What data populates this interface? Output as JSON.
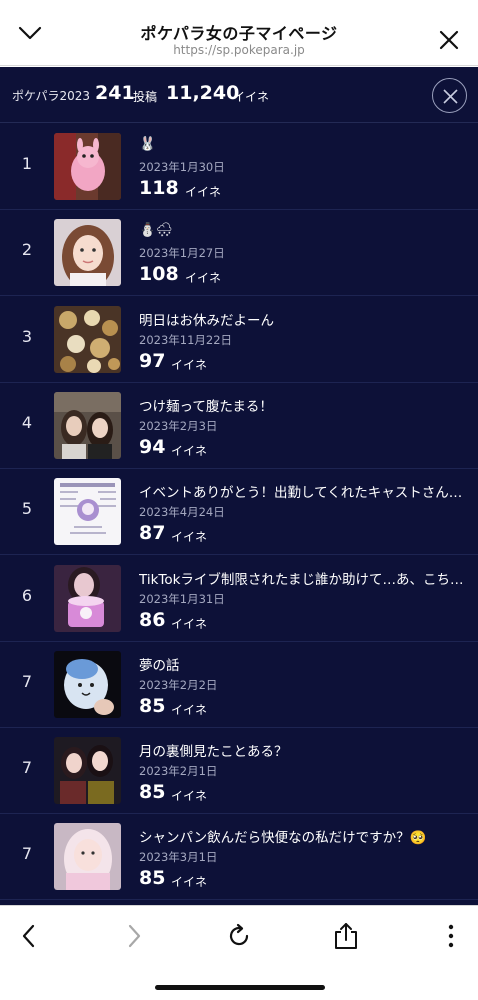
{
  "header": {
    "title": "ポケパラ女の子マイページ",
    "url": "https://sp.pokepara.jp"
  },
  "summary": {
    "tag": "ポケパラ2023",
    "posts_count": "241",
    "posts_unit": "投稿",
    "likes_count": "11,240",
    "likes_unit": "イイネ"
  },
  "like_unit": "イイネ",
  "posts": [
    {
      "rank": "1",
      "title": "🐰",
      "date": "2023年1月30日",
      "count": "118",
      "thumb": "pink-plush"
    },
    {
      "rank": "2",
      "title": "⛄🌨",
      "date": "2023年1月27日",
      "count": "108",
      "thumb": "selfie-brown-hair"
    },
    {
      "rank": "3",
      "title": "明日はお休みだよーん",
      "date": "2023年11月22日",
      "count": "97",
      "thumb": "gold-sweets"
    },
    {
      "rank": "4",
      "title": "つけ麺って腹たまる！",
      "date": "2023年2月3日",
      "count": "94",
      "thumb": "two-girls"
    },
    {
      "rank": "5",
      "title": "イベントありがとう！出勤してくれたキャストさん…",
      "date": "2023年4月24日",
      "count": "87",
      "thumb": "event-flyer"
    },
    {
      "rank": "6",
      "title": "TikTokライブ制限されたまじ誰か助けて…あ、こち…",
      "date": "2023年1月31日",
      "count": "86",
      "thumb": "purple-mug"
    },
    {
      "rank": "7",
      "title": "夢の話",
      "date": "2023年2月2日",
      "count": "85",
      "thumb": "blue-plush"
    },
    {
      "rank": "7",
      "title": "月の裏側見たことある？",
      "date": "2023年2月1日",
      "count": "85",
      "thumb": "two-girls-dark"
    },
    {
      "rank": "7",
      "title": "シャンパン飲んだら快便なの私だけですか？🥺",
      "date": "2023年3月1日",
      "count": "85",
      "thumb": "pink-selfie"
    }
  ],
  "toolbar": {
    "back_icon": "chevron-left-icon",
    "forward_icon": "chevron-right-icon",
    "reload_icon": "reload-icon",
    "share_icon": "share-icon",
    "more_icon": "more-vertical-icon"
  }
}
